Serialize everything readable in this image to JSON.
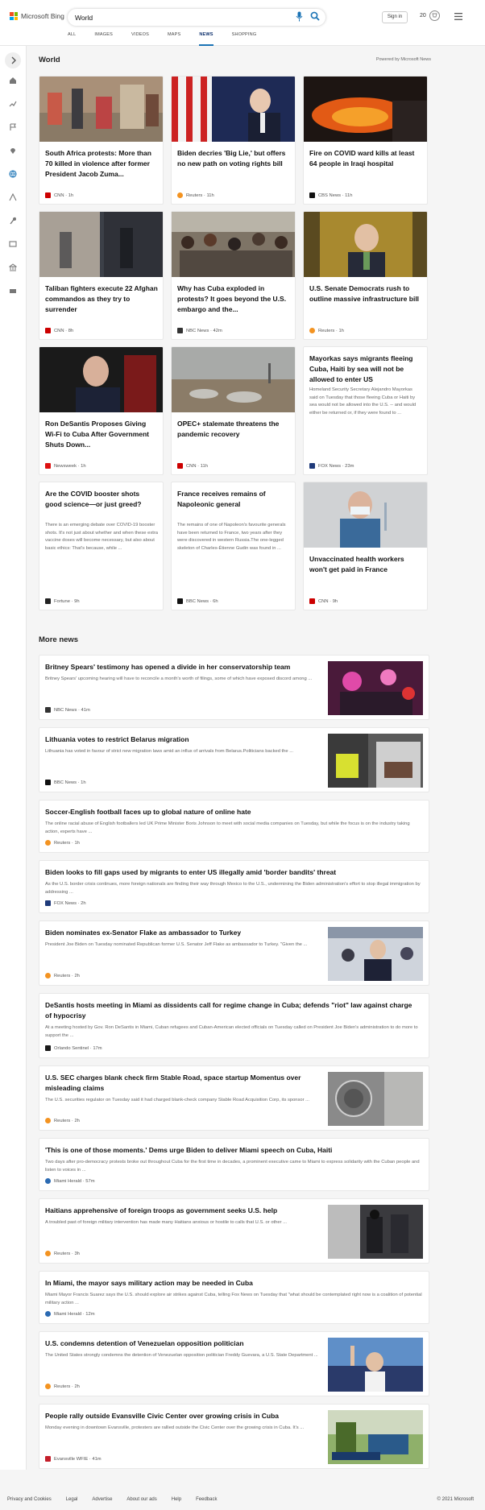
{
  "header": {
    "logo_text": "Microsoft Bing",
    "search_value": "World",
    "signin_label": "Sign in",
    "points": "20"
  },
  "tabs": [
    {
      "label": "ALL"
    },
    {
      "label": "IMAGES"
    },
    {
      "label": "VIDEOS"
    },
    {
      "label": "MAPS"
    },
    {
      "label": "NEWS"
    },
    {
      "label": "SHOPPING"
    }
  ],
  "world": {
    "title": "World",
    "powered": "Powered by Microsoft News",
    "cards": [
      {
        "title": "South Africa protests: More than 70 killed in violence after former President Jacob Zuma...",
        "source": "CNN · 1h"
      },
      {
        "title": "Biden decries 'Big Lie,' but offers no new path on voting rights bill",
        "source": "Reuters · 11h"
      },
      {
        "title": "Fire on COVID ward kills at least 64 people in Iraqi hospital",
        "source": "CBS News · 11h"
      },
      {
        "title": "Taliban fighters execute 22 Afghan commandos as they try to surrender",
        "source": "CNN · 8h"
      },
      {
        "title": "Why has Cuba exploded in protests? It goes beyond the U.S. embargo and the...",
        "source": "NBC News · 42m"
      },
      {
        "title": "U.S. Senate Democrats rush to outline massive infrastructure bill",
        "source": "Reuters · 1h"
      },
      {
        "title": "Ron DeSantis Proposes Giving Wi-Fi to Cuba After Government Shuts Down...",
        "source": "Newsweek · 1h"
      },
      {
        "title": "OPEC+ stalemate threatens the pandemic recovery",
        "source": "CNN · 11h"
      },
      {
        "title": "Mayorkas says migrants fleeing Cuba, Haiti by sea will not be allowed to enter US",
        "snippet": "Homeland Security Secretary Alejandro Mayorkas said on Tuesday that those fleeing Cuba or Haiti by sea would not be allowed into the U.S. -- and would either be returned or, if they were found to ...",
        "source": "FOX News · 23m"
      },
      {
        "title": "Are the COVID booster shots good science—or just greed?",
        "snippet": "There is an emerging debate over COVID-19 booster shots. It's not just about whether and when these extra vaccine doses will become necessary, but also about basic ethics: That's because, while ...",
        "source": "Fortune · 9h"
      },
      {
        "title": "France receives remains of Napoleonic general",
        "snippet": "The remains of one of Napoleon's favourite generals have been returned to France, two years after they were discovered in western Russia.The one-legged skeleton of Charles-Étienne Gudin was found in ...",
        "source": "BBC News · 6h"
      },
      {
        "title": "Unvaccinated health workers won't get paid in France",
        "source": "CNN · 9h"
      }
    ]
  },
  "more_news": {
    "title": "More news",
    "items": [
      {
        "title": "Britney Spears' testimony has opened a divide in her conservatorship team",
        "snippet": "Britney Spears' upcoming hearing will have to reconcile a month's worth of filings, some of which have exposed discord among ...",
        "source": "NBC News · 41m"
      },
      {
        "title": "Lithuania votes to restrict Belarus migration",
        "snippet": "Lithuania has voted in favour of strict new migration laws amid an influx of arrivals from Belarus.Politicians backed the ...",
        "source": "BBC News · 1h"
      },
      {
        "title": "Soccer-English football faces up to global nature of online hate",
        "snippet": "The online racial abuse of English footballers led UK Prime Minister Boris Johnson to meet with social media companies on Tuesday, but while the focus is on the industry taking action, experts have ...",
        "source": "Reuters · 1h"
      },
      {
        "title": "Biden looks to fill gaps used by migrants to enter US illegally amid 'border bandits' threat",
        "snippet": "As the U.S. border crisis continues, more foreign nationals are finding their way through Mexico to the U.S., undermining the Biden administration's effort to stop illegal immigration by addressing ...",
        "source": "FOX News · 2h"
      },
      {
        "title": "Biden nominates ex-Senator Flake as ambassador to Turkey",
        "snippet": "President Joe Biden on Tuesday nominated Republican former U.S. Senator Jeff Flake as ambassador to Turkey. \"Given the ...",
        "source": "Reuters · 2h"
      },
      {
        "title": "DeSantis hosts meeting in Miami as dissidents call for regime change in Cuba; defends \"riot\" law against charge of hypocrisy",
        "snippet": "At a meeting hosted by Gov. Ron DeSantis in Miami, Cuban refugees and Cuban-American elected officials on Tuesday called on President Joe Biden's administration to do more to support the ...",
        "source": "Orlando Sentinel · 17m"
      },
      {
        "title": "U.S. SEC charges blank check firm Stable Road, space startup Momentus over misleading claims",
        "snippet": "The U.S. securities regulator on Tuesday said it had charged blank-check company Stable Road Acquisition Corp, its sponsor ...",
        "source": "Reuters · 2h"
      },
      {
        "title": "'This is one of those moments.' Dems urge Biden to deliver Miami speech on Cuba, Haiti",
        "snippet": "Two days after pro-democracy protests broke out throughout Cuba for the first time in decades, a prominent executive came to Miami to express solidarity with the Cuban people and listen to voices in ...",
        "source": "Miami Herald · 57m"
      },
      {
        "title": "Haitians apprehensive of foreign troops as government seeks U.S. help",
        "snippet": "A troubled past of foreign military intervention has made many Haitians anxious or hostile to calls that U.S. or other ...",
        "source": "Reuters · 3h"
      },
      {
        "title": "In Miami, the mayor says military action may be needed in Cuba",
        "snippet": "Miami Mayor Francis Suarez says the U.S. should explore air strikes against Cuba, telling Fox News on Tuesday that \"what should be contemplated right now is a coalition of potential military action ...",
        "source": "Miami Herald · 12m"
      },
      {
        "title": "U.S. condemns detention of Venezuelan opposition politician",
        "snippet": "The United States strongly condemns the detention of Venezuelan opposition politician Freddy Guevara, a U.S. State Department ...",
        "source": "Reuters · 2h"
      },
      {
        "title": "People rally outside Evansville Civic Center over growing crisis in Cuba",
        "snippet": "Monday evening in downtown Evansville, protesters are rallied outside the Civic Center over the growing crisis in Cuba. It's ...",
        "source": "Evansville WFIE · 41m"
      }
    ]
  },
  "footer": {
    "links": [
      "Privacy and Cookies",
      "Legal",
      "Advertise",
      "About our ads",
      "Help",
      "Feedback"
    ],
    "copyright": "© 2021 Microsoft"
  }
}
